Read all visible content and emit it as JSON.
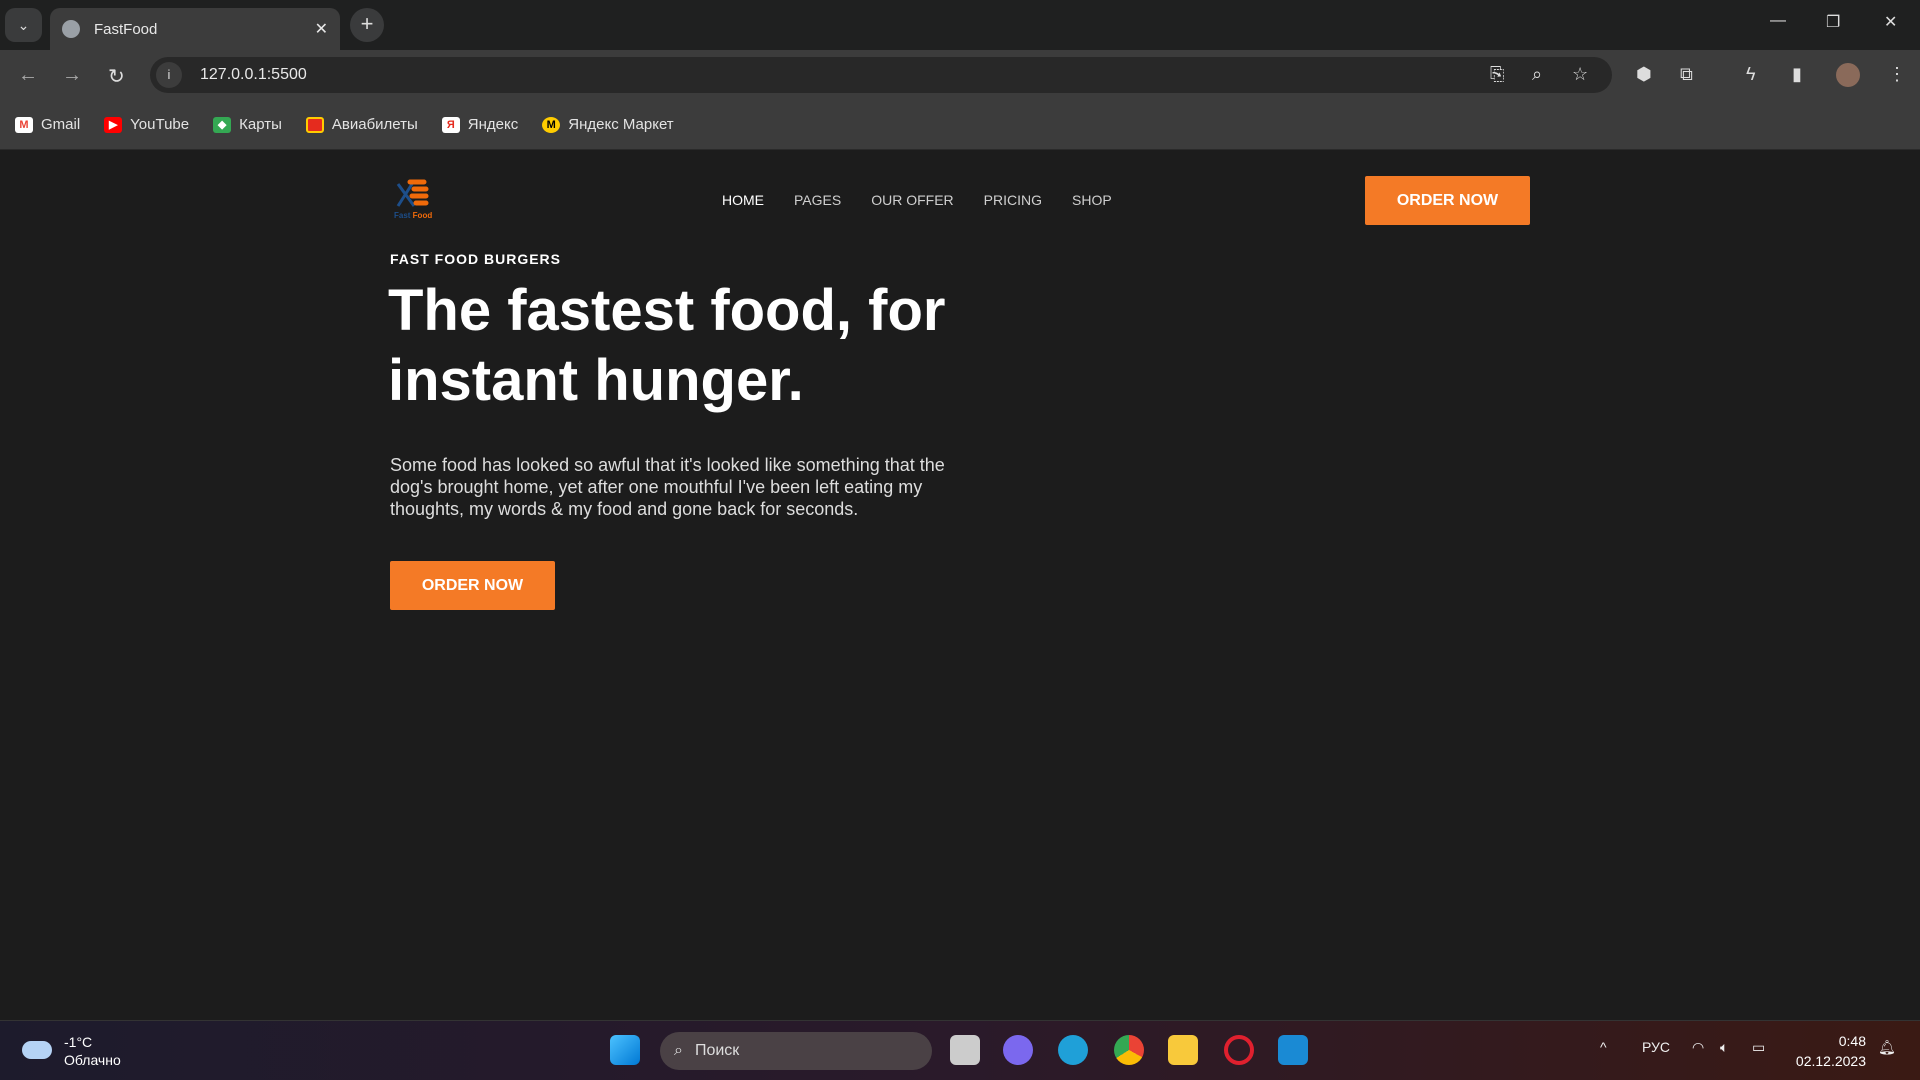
{
  "browser": {
    "tab_title": "FastFood",
    "url": "127.0.0.1:5500",
    "bookmarks": [
      {
        "label": "Gmail",
        "color": "#ea4335"
      },
      {
        "label": "YouTube",
        "color": "#ff0000"
      },
      {
        "label": "Карты",
        "color": "#34a853"
      },
      {
        "label": "Авиабилеты",
        "color": "#e52b1e"
      },
      {
        "label": "Яндекс",
        "color": "#ffffff"
      },
      {
        "label": "Яндекс Маркет",
        "color": "#ffcc00"
      }
    ]
  },
  "site": {
    "logo_text": "Fast Food",
    "nav": [
      "HOME",
      "PAGES",
      "OUR OFFER",
      "PRICING",
      "SHOP"
    ],
    "header_cta": "ORDER NOW",
    "hero": {
      "eyebrow": "FAST FOOD BURGERS",
      "title": "The fastest food, for instant hunger.",
      "text": "Some food has looked so awful that it's looked like something that the dog's brought home, yet after one mouthful I've been left eating my thoughts, my words & my food and gone back for seconds.",
      "cta": "ORDER NOW"
    },
    "accent": "#f47a26"
  },
  "taskbar": {
    "temp": "-1°C",
    "weather": "Облачно",
    "search_placeholder": "Поиск",
    "lang": "РУС",
    "time": "0:48",
    "date": "02.12.2023"
  }
}
